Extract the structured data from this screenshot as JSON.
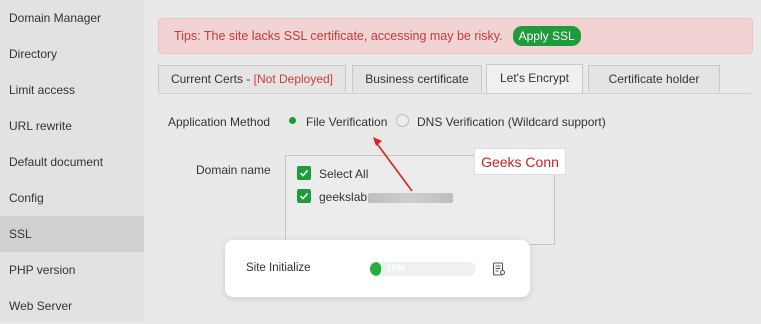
{
  "sidebar": {
    "items": [
      {
        "label": "Domain Manager"
      },
      {
        "label": "Directory"
      },
      {
        "label": "Limit access"
      },
      {
        "label": "URL rewrite"
      },
      {
        "label": "Default document"
      },
      {
        "label": "Config"
      },
      {
        "label": "SSL"
      },
      {
        "label": "PHP version"
      },
      {
        "label": "Web Server"
      }
    ],
    "active": "SSL"
  },
  "alert": {
    "text": "Tips: The site lacks SSL certificate, accessing may be risky.",
    "button": "Apply SSL"
  },
  "tabs": [
    {
      "label": "Current Certs - ",
      "status": "[Not Deployed]"
    },
    {
      "label": "Business certificate"
    },
    {
      "label": "Let's Encrypt",
      "active": true
    },
    {
      "label": "Certificate holder"
    }
  ],
  "form": {
    "method_label": "Application Method",
    "options": [
      "File Verification",
      "DNS Verification (Wildcard support)"
    ],
    "selected": "File Verification",
    "domain_label": "Domain name",
    "select_all": "Select All",
    "domain": "geekslab."
  },
  "annotation": {
    "text": "Geeks Conn"
  },
  "modal": {
    "label": "Site Initialize",
    "progress": 0.1,
    "progress_text": "10%"
  },
  "colors": {
    "accent": "#1e9b3a",
    "alert_text": "#c33a3a",
    "annotation": "#d31c1c"
  }
}
